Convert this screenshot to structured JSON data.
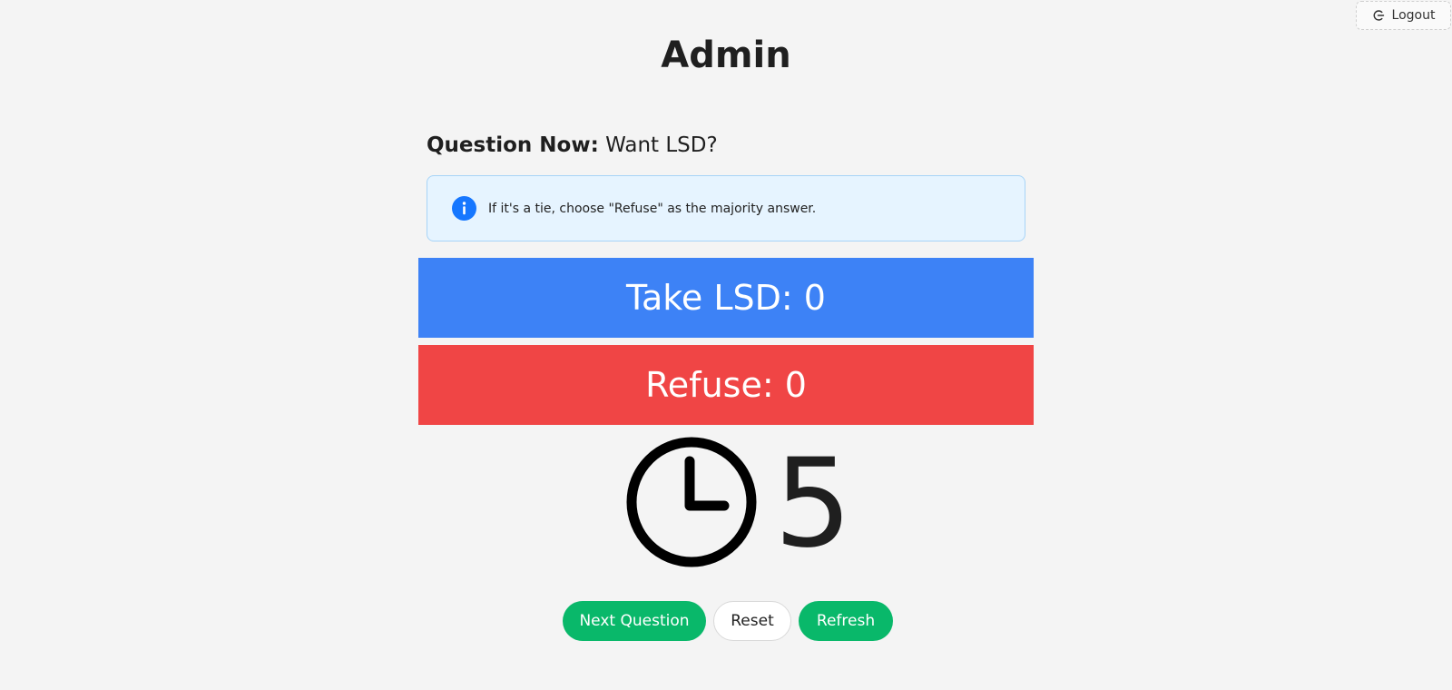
{
  "header": {
    "title": "Admin",
    "logout_label": "Logout",
    "logout_icon": "logout-icon"
  },
  "question": {
    "label": "Question Now:",
    "text": "Want LSD?"
  },
  "alert": {
    "icon": "info-icon",
    "message": "If it's a tie, choose \"Refuse\" as the majority answer."
  },
  "votes": {
    "take_label": "Take LSD: 0",
    "refuse_label": "Refuse: 0"
  },
  "timer": {
    "icon": "clock-icon",
    "value": "5"
  },
  "actions": {
    "next_label": "Next Question",
    "reset_label": "Reset",
    "refresh_label": "Refresh"
  },
  "colors": {
    "background": "#f4f4f4",
    "take_bar": "#3d82f6",
    "refuse_bar": "#f04545",
    "primary_button": "#09b86a",
    "alert_background": "#e6f4ff",
    "alert_border": "#a7d4f7",
    "info_icon": "#1677ff"
  }
}
